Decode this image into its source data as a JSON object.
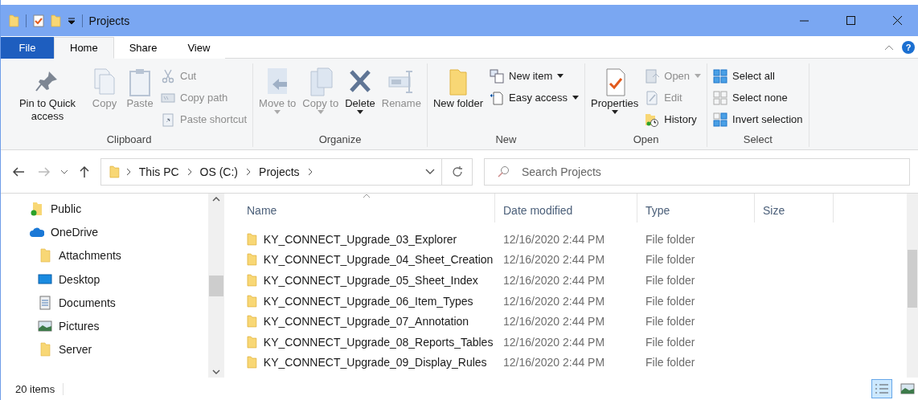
{
  "window": {
    "title": "Projects"
  },
  "ribbon_tabs": [
    {
      "label": "File",
      "kind": "file",
      "selected": false
    },
    {
      "label": "Home",
      "kind": "tab",
      "selected": true
    },
    {
      "label": "Share",
      "kind": "tab",
      "selected": false
    },
    {
      "label": "View",
      "kind": "tab",
      "selected": false
    }
  ],
  "help": {
    "label": "?"
  },
  "ribbon_groups": [
    {
      "label": "Clipboard",
      "commands": [
        {
          "kind": "large",
          "label": "Pin to Quick access",
          "disabled": false,
          "dropdown": false
        },
        {
          "kind": "large",
          "label": "Copy",
          "disabled": true,
          "dropdown": false
        },
        {
          "kind": "large",
          "label": "Paste",
          "disabled": true,
          "dropdown": false
        },
        {
          "kind": "stack",
          "items": [
            {
              "label": "Cut",
              "disabled": true,
              "dropdown": false
            },
            {
              "label": "Copy path",
              "disabled": true,
              "dropdown": false
            },
            {
              "label": "Paste shortcut",
              "disabled": true,
              "dropdown": false
            }
          ]
        }
      ]
    },
    {
      "label": "Organize",
      "commands": [
        {
          "kind": "large",
          "label": "Move to",
          "disabled": true,
          "dropdown": true
        },
        {
          "kind": "large",
          "label": "Copy to",
          "disabled": true,
          "dropdown": true
        },
        {
          "kind": "large",
          "label": "Delete",
          "disabled": false,
          "dropdown": true
        },
        {
          "kind": "large",
          "label": "Rename",
          "disabled": true,
          "dropdown": false
        }
      ]
    },
    {
      "label": "New",
      "commands": [
        {
          "kind": "large",
          "label": "New folder",
          "disabled": false,
          "dropdown": false
        },
        {
          "kind": "stack",
          "items": [
            {
              "label": "New item",
              "disabled": false,
              "dropdown": true
            },
            {
              "label": "Easy access",
              "disabled": false,
              "dropdown": true
            }
          ]
        }
      ]
    },
    {
      "label": "Open",
      "commands": [
        {
          "kind": "large",
          "label": "Properties",
          "disabled": false,
          "dropdown": true
        },
        {
          "kind": "stack",
          "items": [
            {
              "label": "Open",
              "disabled": true,
              "dropdown": true
            },
            {
              "label": "Edit",
              "disabled": true,
              "dropdown": false
            },
            {
              "label": "History",
              "disabled": false,
              "dropdown": false
            }
          ]
        }
      ]
    },
    {
      "label": "Select",
      "commands": [
        {
          "kind": "stack",
          "items": [
            {
              "label": "Select all",
              "disabled": false,
              "dropdown": false
            },
            {
              "label": "Select none",
              "disabled": false,
              "dropdown": false
            },
            {
              "label": "Invert selection",
              "disabled": false,
              "dropdown": false
            }
          ]
        }
      ]
    }
  ],
  "navigation": {
    "back_disabled": false,
    "forward_disabled": true
  },
  "breadcrumb": [
    "This PC",
    "OS (C:)",
    "Projects"
  ],
  "search": {
    "placeholder": "Search Projects"
  },
  "sidebar": {
    "items": [
      {
        "label": "Public",
        "kind": "shared"
      },
      {
        "label": "OneDrive",
        "kind": "cloud",
        "children": [
          {
            "label": "Attachments",
            "kind": "folder"
          },
          {
            "label": "Desktop",
            "kind": "desktop"
          },
          {
            "label": "Documents",
            "kind": "documents"
          },
          {
            "label": "Pictures",
            "kind": "pictures"
          },
          {
            "label": "Server",
            "kind": "folder"
          }
        ]
      }
    ]
  },
  "table": {
    "columns": [
      {
        "label": "Name",
        "sorted": true
      },
      {
        "label": "Date modified",
        "sorted": false
      },
      {
        "label": "Type",
        "sorted": false
      },
      {
        "label": "Size",
        "sorted": false
      }
    ],
    "rows": [
      {
        "name": "KY_CONNECT_Upgrade_03_Explorer",
        "date": "12/16/2020 2:44 PM",
        "type": "File folder"
      },
      {
        "name": "KY_CONNECT_Upgrade_04_Sheet_Creation",
        "date": "12/16/2020 2:44 PM",
        "type": "File folder"
      },
      {
        "name": "KY_CONNECT_Upgrade_05_Sheet_Index",
        "date": "12/16/2020 2:44 PM",
        "type": "File folder"
      },
      {
        "name": "KY_CONNECT_Upgrade_06_Item_Types",
        "date": "12/16/2020 2:44 PM",
        "type": "File folder"
      },
      {
        "name": "KY_CONNECT_Upgrade_07_Annotation",
        "date": "12/16/2020 2:44 PM",
        "type": "File folder"
      },
      {
        "name": "KY_CONNECT_Upgrade_08_Reports_Tables",
        "date": "12/16/2020 2:44 PM",
        "type": "File folder"
      },
      {
        "name": "KY_CONNECT_Upgrade_09_Display_Rules",
        "date": "12/16/2020 2:44 PM",
        "type": "File folder"
      }
    ]
  },
  "status_bar": {
    "count": "20 items"
  },
  "views": [
    {
      "kind": "details",
      "selected": true
    },
    {
      "kind": "large_icons",
      "selected": false
    }
  ]
}
